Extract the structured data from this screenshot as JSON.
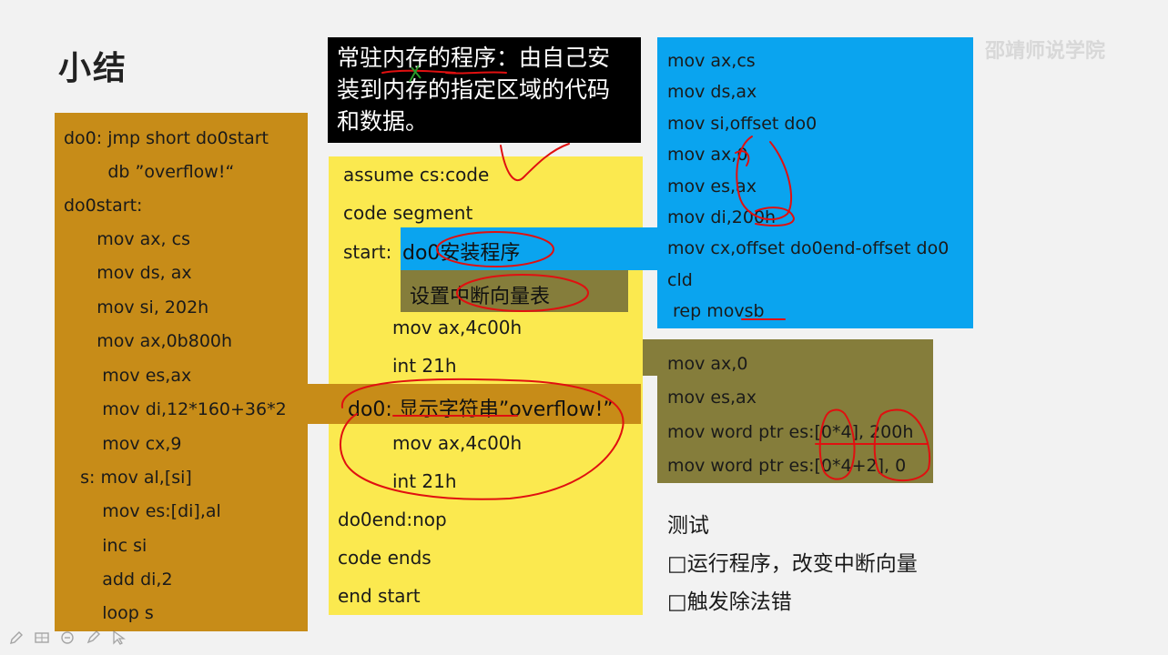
{
  "title": "小结",
  "watermark": "邵靖师说学院",
  "definition": {
    "lines": [
      "常驻内存的程序：由自己安",
      "装到内存的指定区域的代码",
      "和数据。"
    ]
  },
  "left_code": [
    "do0: jmp short do0start",
    "        db ”overflow!“",
    "do0start:",
    "      mov ax, cs",
    "      mov ds, ax",
    "      mov si, 202h",
    "      mov ax,0b800h",
    "       mov es,ax",
    "       mov di,12*160+36*2",
    "       mov cx,9",
    "   s: mov al,[si]",
    "       mov es:[di],al",
    "       inc si",
    "       add di,2",
    "       loop s"
  ],
  "middle_code": {
    "line_assume": "assume cs:code",
    "line_segment": "code segment",
    "line_start": "start:",
    "line_mov1": "mov ax,4c00h",
    "line_int1": "int 21h",
    "line_mov2": "mov ax,4c00h",
    "line_int2": "int 21h",
    "line_end_nop": "do0end:nop",
    "line_ends": "code ends",
    "line_end_start": "end start"
  },
  "bands": {
    "install": "do0安装程序",
    "vector": "设置中断向量表",
    "display": "do0: 显示字符串”overflow!”"
  },
  "blue_code": [
    "mov ax,cs",
    "mov ds,ax",
    "mov si,offset do0",
    "mov ax,0",
    "mov es,ax",
    "mov di,200h",
    "mov cx,offset do0end-offset do0",
    "cld",
    " rep movsb"
  ],
  "olive_code": [
    "mov ax,0",
    "mov es,ax",
    "mov word ptr es:[0*4], 200h",
    "mov word ptr es:[0*4+2], 0"
  ],
  "test": {
    "heading": "测试",
    "items": [
      "□运行程序，改变中断向量",
      "□触发除法错"
    ]
  },
  "colors": {
    "yellow": "#fbe94f",
    "orange": "#c78c18",
    "blue": "#0aa4ef",
    "olive": "#857d3b",
    "black": "#000000",
    "annotation_red": "#e01010"
  },
  "toolbar_icons": [
    "pen-icon",
    "slide-grid-icon",
    "eraser-icon",
    "pencil-icon",
    "pointer-icon"
  ]
}
